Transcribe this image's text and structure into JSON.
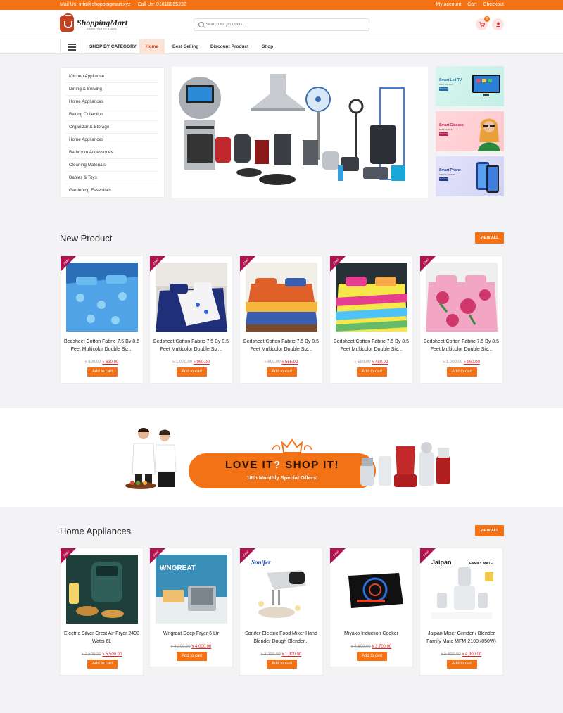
{
  "topbar": {
    "mail": "Mail Us: info@shoppingmart.xyz",
    "call": "Call Us: 01818865232",
    "links": [
      "My account",
      "Cart",
      "Checkout"
    ]
  },
  "header": {
    "logo_name": "ShoppingMart",
    "logo_tagline": "COMMITTED TO SERVE",
    "search_placeholder": "Search for products...",
    "cart_count": "0"
  },
  "nav": {
    "category_label": "SHOP BY CATEGORY",
    "items": [
      "Home",
      "Best Selling",
      "Discount Product",
      "Shop"
    ],
    "active": "Home"
  },
  "categories": [
    "Kitchen Appliance",
    "Dining & Serving",
    "Home Appliances",
    "Baking Collection",
    "Organizar & Storage",
    "Home Appliances",
    "Bathroom Accessories",
    "Cleaning Materials",
    "Babies & Toys",
    "Gardening Essentials"
  ],
  "promos": [
    {
      "title": "Smart Led TV",
      "sub": "NOW 70% OFF",
      "btn": "Shop Now"
    },
    {
      "title": "Smart Glasses",
      "sub": "BEST CHOICE",
      "btn": "Shop Now"
    },
    {
      "title": "Smart Phone",
      "sub": "SPECIAL OFFER",
      "btn": "Shop Now"
    }
  ],
  "new_product": {
    "title": "New Product",
    "view_all": "VIEW ALL",
    "products": [
      {
        "name": "Bedsheet Cotton Fabric 7.5 By 8.5 Feet Multicolor Double Siz...",
        "old": "৳ 800.00",
        "new": "৳ 630.00",
        "badge": "Sale!",
        "btn": "Add to cart"
      },
      {
        "name": "Bedsheet Cotton Fabric 7.5 By 8.5 Feet Multicolor Double Siz...",
        "old": "৳ 1,070.00",
        "new": "৳ 960.00",
        "badge": "Sale!",
        "btn": "Add to cart"
      },
      {
        "name": "Bedsheet Cotton Fabric 7.5 By 8.5 Feet Multicolor Double Siz...",
        "old": "৳ 690.00",
        "new": "৳ 555.00",
        "badge": "Sale!",
        "btn": "Add to cart"
      },
      {
        "name": "Bedsheet Cotton Fabric 7.5 By 8.5 Feet Multicolor Double Siz...",
        "old": "৳ 580.00",
        "new": "৳ 480.00",
        "badge": "Sale!",
        "btn": "Add to cart"
      },
      {
        "name": "Bedsheet Cotton Fabric 7.5 By 8.5 Feet Multicolor Double Siz...",
        "old": "৳ 1,000.00",
        "new": "৳ 960.00",
        "badge": "Sale!",
        "btn": "Add to cart"
      }
    ]
  },
  "offer_banner": {
    "title_a": "LOVE IT",
    "title_q": "?",
    "title_b": " SHOP IT!",
    "sub": "18th Monthly Special Offers!"
  },
  "home_appliances": {
    "title": "Home Appliances",
    "view_all": "VIEW ALL",
    "products": [
      {
        "name": "Electric Silver Crest Air Fryer 2400 Watts 6L",
        "old": "৳ 7,500.00",
        "new": "৳ 5,500.00",
        "badge": "Sale!",
        "btn": "Add to cart"
      },
      {
        "name": "Wngreat Deep Fryer 6 Ltr",
        "old": "৳ 4,200.00",
        "new": "৳ 4,000.00",
        "badge": "Sale!",
        "btn": "Add to cart"
      },
      {
        "name": "Sonifer Electric Food Mixer Hand Blender Dough Blender...",
        "old": "৳ 3,200.00",
        "new": "৳ 1,900.00",
        "badge": "Sale!",
        "btn": "Add to cart"
      },
      {
        "name": "Miyako Induction Cooker",
        "old": "৳ 4,500.00",
        "new": "৳ 3,700.00",
        "badge": "Sale!",
        "btn": "Add to cart"
      },
      {
        "name": "Jaipan Mixer Grinder / Blender Family Mate MFM-2100 (850W)",
        "old": "৳ 5,600.00",
        "new": "৳ 4,900.00",
        "badge": "Sale!",
        "btn": "Add to cart"
      }
    ],
    "image_labels": [
      "WNGREAT",
      "Sonifer",
      "Jaipan",
      "FAMILY MATE"
    ]
  },
  "colors": {
    "accent": "#f47216",
    "sale": "#b0124f",
    "price": "#d8262c"
  }
}
